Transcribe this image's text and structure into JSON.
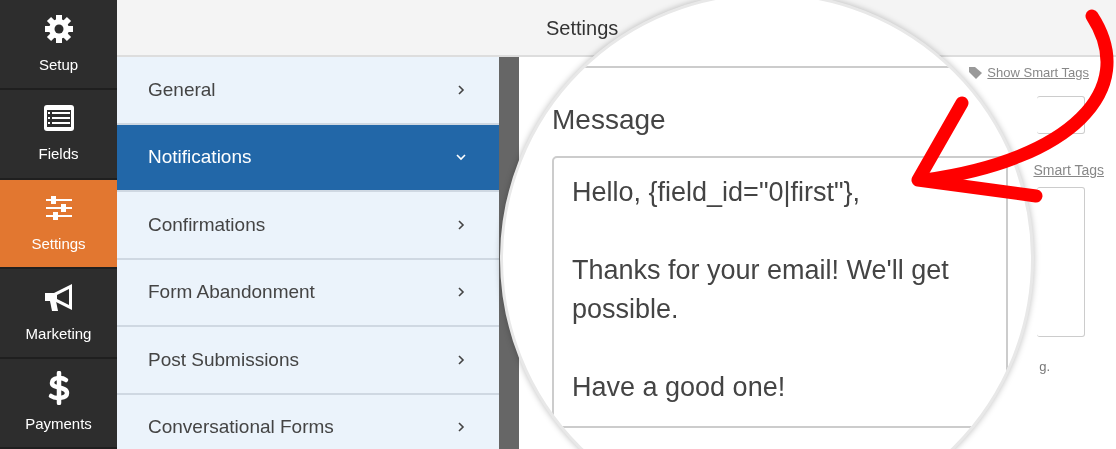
{
  "sidebar": {
    "items": [
      {
        "label": "Setup",
        "kind": "gear",
        "selected": false
      },
      {
        "label": "Fields",
        "kind": "list",
        "selected": false
      },
      {
        "label": "Settings",
        "kind": "sliders",
        "selected": true
      },
      {
        "label": "Marketing",
        "kind": "megaphone",
        "selected": false
      },
      {
        "label": "Payments",
        "kind": "dollar",
        "selected": false
      }
    ]
  },
  "top_bar": {
    "title": "Settings"
  },
  "settings_menu": {
    "items": [
      {
        "label": "General",
        "selected": false
      },
      {
        "label": "Notifications",
        "selected": true
      },
      {
        "label": "Confirmations",
        "selected": false
      },
      {
        "label": "Form Abandonment",
        "selected": false
      },
      {
        "label": "Post Submissions",
        "selected": false
      },
      {
        "label": "Conversational Forms",
        "selected": false
      }
    ]
  },
  "panel": {
    "smart_tags_link": "Show Smart Tags",
    "smart_tags_link_2": "Smart Tags",
    "hint": "g."
  },
  "magnifier": {
    "label": "Message",
    "message": [
      "Hello, {field_id=\"0|first\"},",
      "Thanks for your email! We'll get\npossible.",
      "Have a good one!"
    ]
  }
}
